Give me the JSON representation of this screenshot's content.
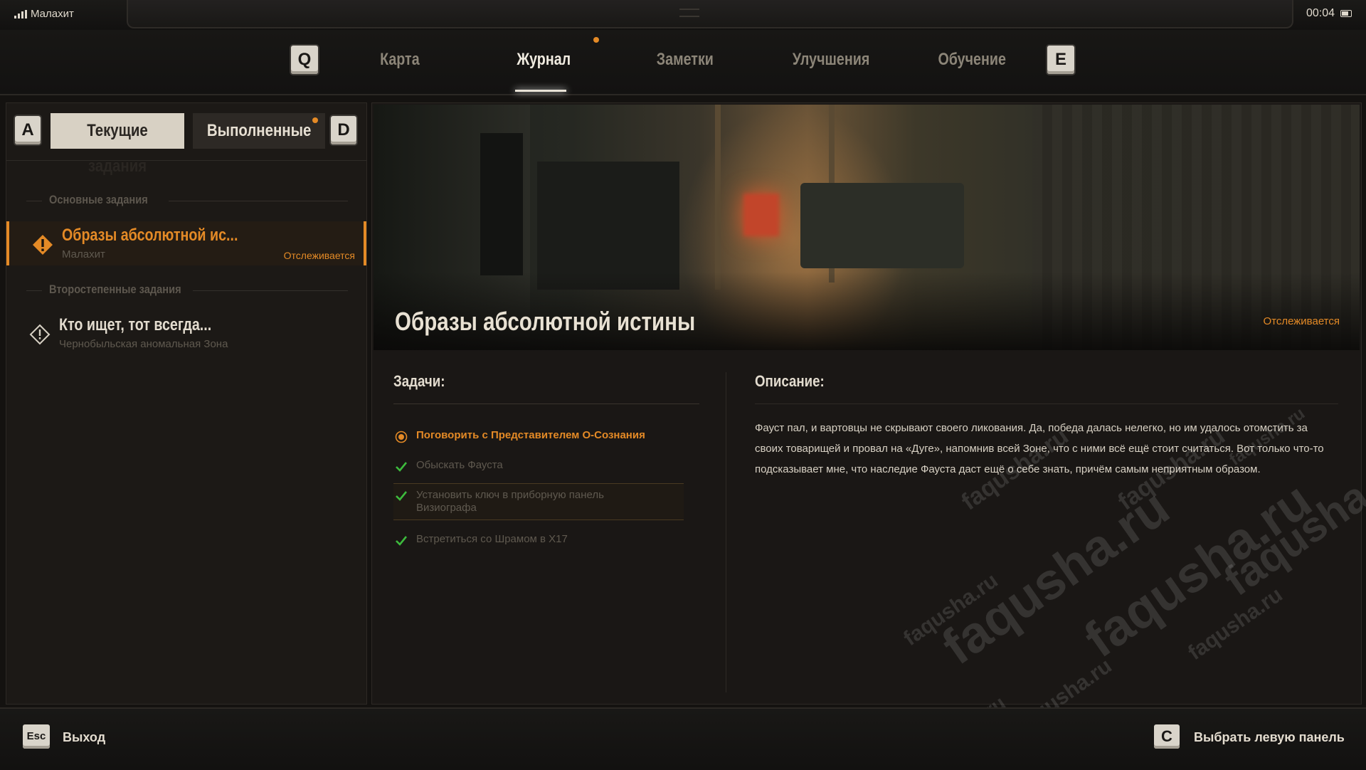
{
  "status": {
    "network": "Малахит",
    "time": "00:04"
  },
  "nav": {
    "prev_key": "Q",
    "next_key": "E",
    "tabs": [
      "Карта",
      "Журнал",
      "Заметки",
      "Улучшения",
      "Обучение"
    ],
    "active_tab": "Журнал"
  },
  "left": {
    "prev_key": "A",
    "next_key": "D",
    "tab_current": "Текущие задания",
    "tab_done": "Выполненные",
    "main_section": "Основные задания",
    "side_section": "Второстепенные задания",
    "quests": [
      {
        "title": "Образы абсолютной ис...",
        "location": "Малахит",
        "status": "Отслеживается"
      },
      {
        "title": "Кто ищет, тот всегда...",
        "location": "Чернобыльская аномальная Зона",
        "status": ""
      }
    ]
  },
  "detail": {
    "title": "Образы абсолютной истины",
    "status": "Отслеживается",
    "tasks_header": "Задачи:",
    "tasks": [
      {
        "text": "Поговорить с Представителем О-Сознания",
        "state": "active"
      },
      {
        "text": "Обыскать Фауста",
        "state": "done"
      },
      {
        "text": "Установить ключ в приборную панель Визиографа",
        "state": "done"
      },
      {
        "text": "Встретиться со Шрамом в X17",
        "state": "done"
      }
    ],
    "description_header": "Описание:",
    "description": "Фауст пал, и вартовцы не скрывают своего ликования. Да, победа далась нелегко, но им удалось отомстить за своих товарищей и провал на «Дуге», напомнив всей Зоне, что с ними всё ещё стоит считаться. Вот только что-то подсказывает мне, что наследие Фауста даст ещё о себе знать, причём самым неприятным образом."
  },
  "watermark": "faqusha.ru",
  "bottom": {
    "exit_key": "Esc",
    "exit_label": "Выход",
    "select_key": "C",
    "select_label": "Выбрать левую панель"
  },
  "colors": {
    "accent": "#e48a26",
    "success": "#3dbb3d",
    "keycap": "#d9d4ca"
  }
}
